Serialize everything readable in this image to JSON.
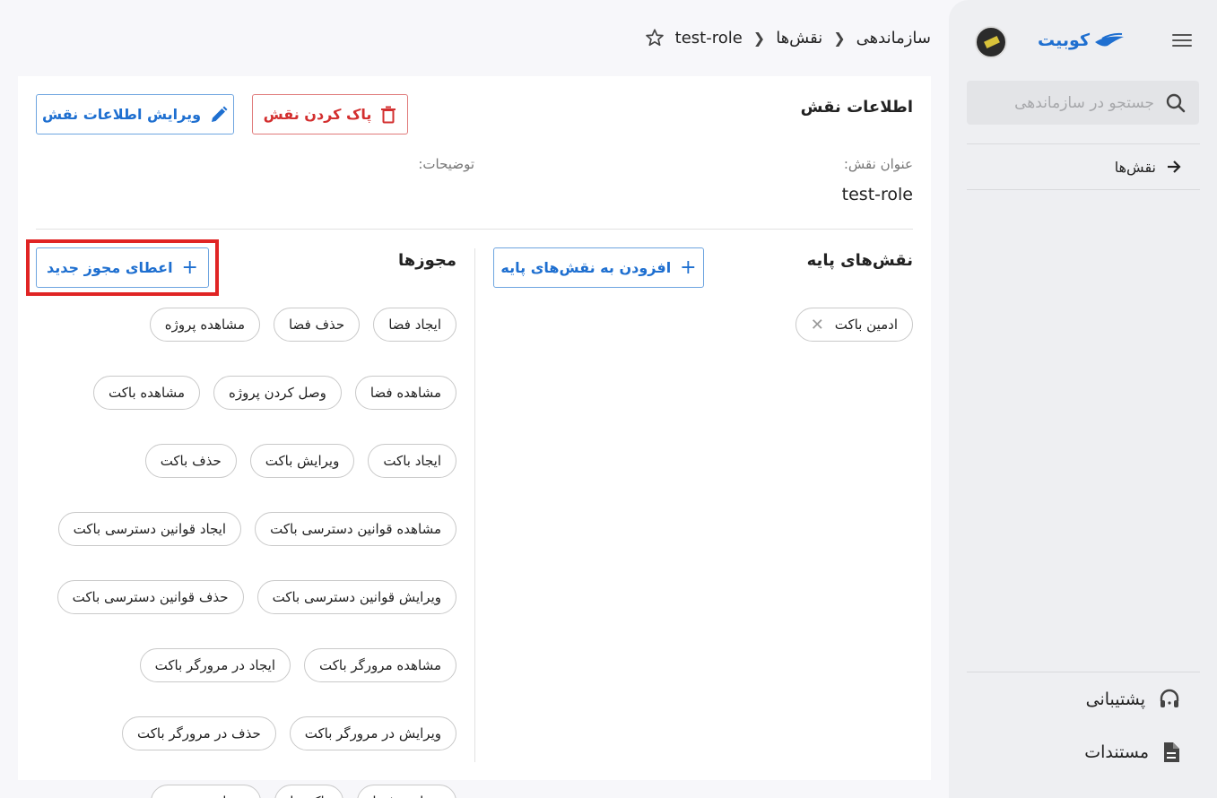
{
  "sidebar": {
    "logo_text": "کوبیت",
    "search_placeholder": "جستجو در سازماندهی",
    "nav_items": [
      {
        "label": "نقش‌ها"
      }
    ],
    "bottom": [
      {
        "label": "پشتیبانی"
      },
      {
        "label": "مستندات"
      }
    ]
  },
  "breadcrumb": [
    "سازماندهی",
    "نقش‌ها",
    "test-role"
  ],
  "role_info": {
    "title": "اطلاعات نقش",
    "delete_label": "پاک کردن نقش",
    "edit_label": "ویرایش اطلاعات نقش",
    "name_label": "عنوان نقش:",
    "name_value": "test-role",
    "desc_label": "توضیحات:"
  },
  "base_roles": {
    "title": "نقش‌های پایه",
    "add_label": "افزودن به نقش‌های پایه",
    "items": [
      "ادمین باکت"
    ]
  },
  "permissions": {
    "title": "مجوزها",
    "add_label": "اعطای مجوز جدید",
    "items": [
      "ایجاد فضا",
      "حذف فضا",
      "مشاهده پروژه",
      "مشاهده فضا",
      "وصل کردن پروژه",
      "مشاهده باکت",
      "ایجاد باکت",
      "ویرایش باکت",
      "حذف باکت",
      "مشاهده قوانین دسترسی باکت",
      "ایجاد قوانین دسترسی باکت",
      "ویرایش قوانین دسترسی باکت",
      "حذف قوانین دسترسی باکت",
      "مشاهده مرورگر باکت",
      "ایجاد در مرورگر باکت",
      "ویرایش در مرورگر باکت",
      "حذف در مرورگر باکت",
      "ویرایش فضا",
      "باکت‌ها",
      "مشاهده پروژه"
    ]
  }
}
